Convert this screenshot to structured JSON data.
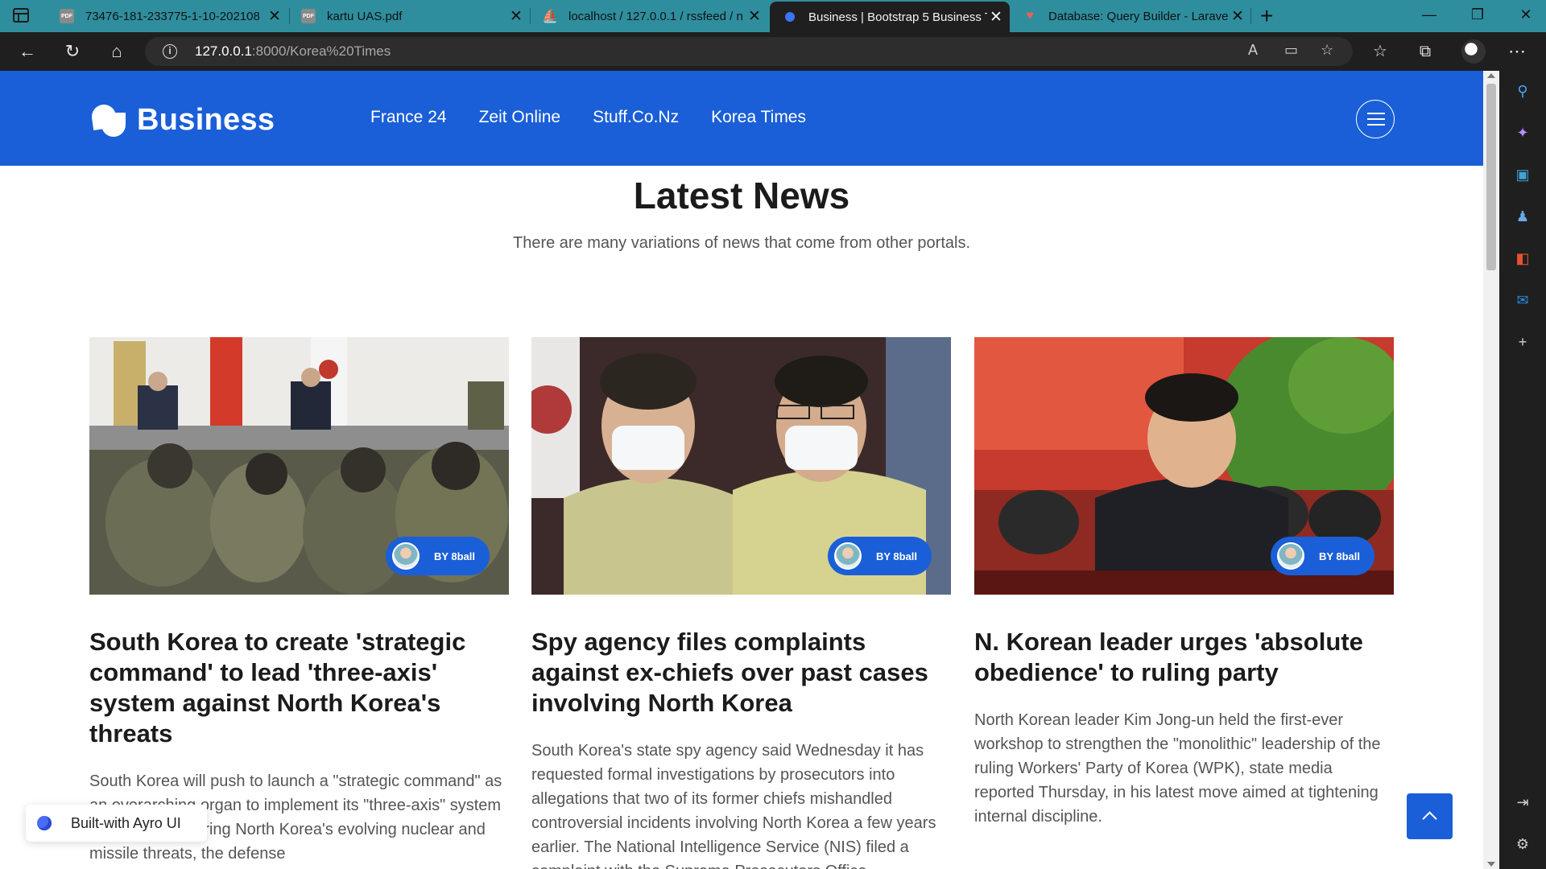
{
  "browser": {
    "tabs": [
      {
        "title": "73476-181-233775-1-10-202108",
        "icon": "pdf-icon"
      },
      {
        "title": "kartu UAS.pdf",
        "icon": "pdf-icon"
      },
      {
        "title": "localhost / 127.0.0.1 / rssfeed / n",
        "icon": "phpmyadmin-icon"
      },
      {
        "title": "Business | Bootstrap 5 Business T",
        "icon": "bootstrap-icon"
      },
      {
        "title": "Database: Query Builder - Larave",
        "icon": "laravel-icon"
      }
    ],
    "active_tab": 3,
    "url_host": "127.0.0.1",
    "url_rest": ":8000/Korea%20Times"
  },
  "site": {
    "brand": "Business",
    "nav": [
      "France 24",
      "Zeit Online",
      "Stuff.Co.Nz",
      "Korea Times"
    ],
    "section_title": "Latest News",
    "section_subtitle": "There are many variations of news that come from other portals.",
    "articles": [
      {
        "author": "BY 8ball",
        "title": "South Korea to create 'strategic command' to lead 'three-axis' system against North Korea's threats",
        "excerpt": "South Korea will push to launch a \"strategic command\" as an overarching organ to implement its \"three-axis\" system aimed at countering North Korea's evolving nuclear and missile threats, the defense"
      },
      {
        "author": "BY 8ball",
        "title": "Spy agency files complaints against ex-chiefs over past cases involving North Korea",
        "excerpt": "South Korea's state spy agency said Wednesday it has requested formal investigations by prosecutors into allegations that two of its former chiefs mishandled controversial incidents involving North Korea a few years earlier. The National Intelligence Service (NIS) filed a complaint with the Supreme Prosecutors Office"
      },
      {
        "author": "BY 8ball",
        "title": "N. Korean leader urges 'absolute obedience' to ruling party",
        "excerpt": "North Korean leader Kim Jong-un held the first-ever workshop to strengthen the \"monolithic\" leadership of the ruling Workers' Party of Korea (WPK), state media reported Thursday, in his latest move aimed at tightening internal discipline."
      }
    ],
    "built_with": "Built-with Ayro UI"
  },
  "colors": {
    "brand_blue": "#1a5fd8",
    "tabbar": "#2f8e9e",
    "chrome_dark": "#1f1f1f"
  }
}
